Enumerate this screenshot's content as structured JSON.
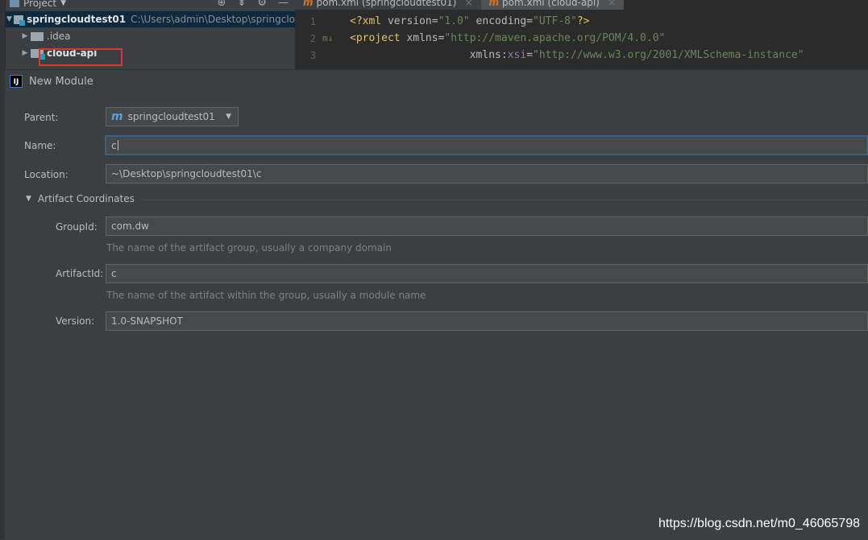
{
  "project": {
    "header_title": "Project",
    "tree": [
      {
        "name": "springcloudtest01",
        "path": "C:\\Users\\admin\\Desktop\\springclo"
      },
      {
        "name": ".idea"
      },
      {
        "name": "cloud-api"
      }
    ]
  },
  "editor": {
    "tabs": [
      "pom.xml (springcloudtest01)",
      "pom.xml (cloud-api)"
    ],
    "lines": [
      {
        "num": "1",
        "gutter": "",
        "tag_open": "<?xml ",
        "attr": "version=",
        "str": "\"1.0\"",
        "attr2": " encoding=",
        "str2": "\"UTF-8\"",
        "tag_close": "?>"
      },
      {
        "num": "2",
        "gutter": "m↓",
        "tag_open": "<project ",
        "attr": "xmlns=",
        "str": "\"http://maven.apache.org/POM/4.0.0\"",
        "attr2": "",
        "str2": "",
        "tag_close": ""
      },
      {
        "num": "3",
        "gutter": "",
        "tag_open": "         ",
        "attr": "xmlns:",
        "ns": "xsi",
        "attr2": "=",
        "str2": "\"http://www.w3.org/2001/XMLSchema-instance\"",
        "tag_close": ""
      }
    ]
  },
  "dialog": {
    "title": "New Module",
    "parent_label": "Parent:",
    "parent_value": "springcloudtest01",
    "name_label": "Name:",
    "name_value": "c",
    "location_label": "Location:",
    "location_value": "~\\Desktop\\springcloudtest01\\c",
    "section_label": "Artifact Coordinates",
    "groupid_label": "GroupId:",
    "groupid_value": "com.dw",
    "groupid_hint": "The name of the artifact group, usually a company domain",
    "artifactid_label": "ArtifactId:",
    "artifactid_value": "c",
    "artifactid_hint": "The name of the artifact within the group, usually a module name",
    "version_label": "Version:",
    "version_value": "1.0-SNAPSHOT"
  },
  "watermark": "https://blog.csdn.net/m0_46065798"
}
